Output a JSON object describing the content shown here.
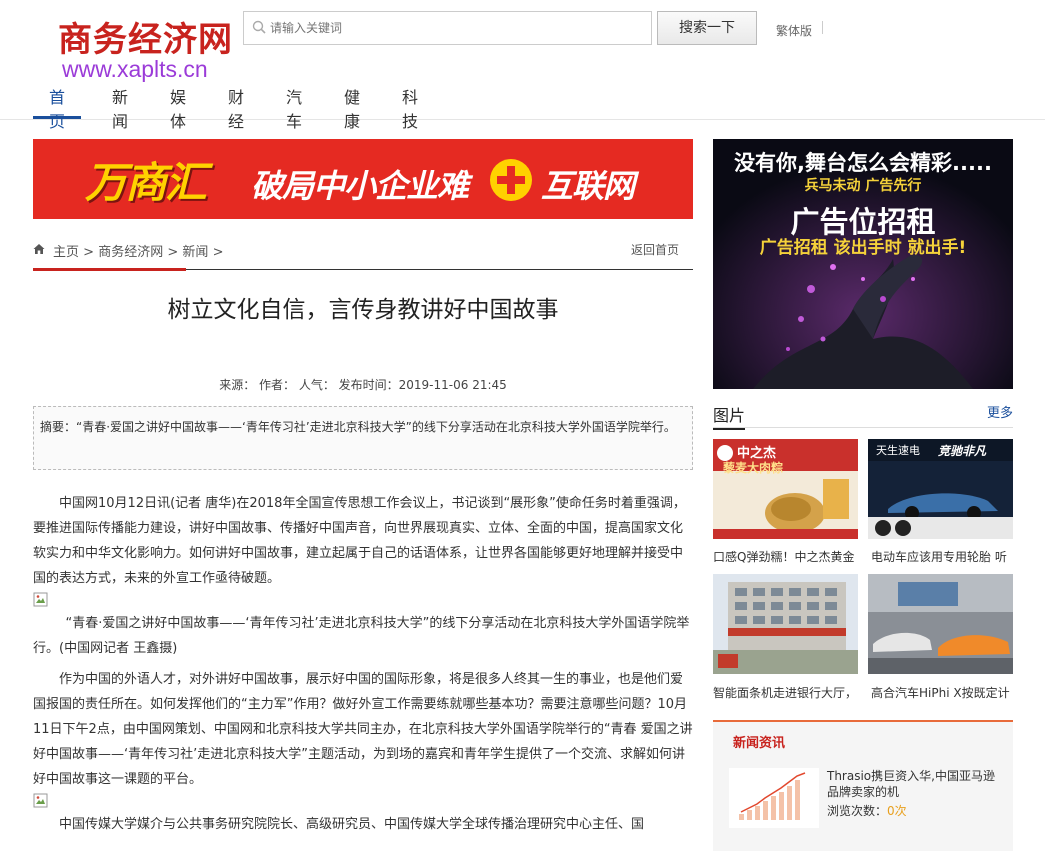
{
  "header": {
    "logo": "商务经济网",
    "url": "www.xaplts.cn",
    "search_placeholder": "请输入关键词",
    "search_button": "搜索一下",
    "traditional": "繁体版"
  },
  "nav": {
    "items": [
      "首页",
      "新闻",
      "娱体",
      "财经",
      "汽车",
      "健康",
      "科技"
    ],
    "active_index": 0
  },
  "banner": {
    "brand": "万商汇",
    "slogan_left": "破局中小企业难",
    "slogan_right": "互联网"
  },
  "breadcrumb": {
    "items": [
      "主页",
      "商务经济网",
      "新闻"
    ],
    "separator": ">",
    "back": "返回首页"
  },
  "article": {
    "title": "树立文化自信，言传身教讲好中国故事",
    "meta": "来源： 作者： 人气： 发布时间：2019-11-06 21:45",
    "summary": "摘要：“青春·爱国之讲好中国故事——‘青年传习社’走进北京科技大学”的线下分享活动在北京科技大学外国语学院举行。",
    "paragraphs": [
      "中国网10月12日讯(记者 唐华)在2018年全国宣传思想工作会议上，书记谈到“展形象”使命任务时着重强调，要推进国际传播能力建设，讲好中国故事、传播好中国声音，向世界展现真实、立体、全面的中国，提高国家文化软实力和中华文化影响力。如何讲好中国故事，建立起属于自己的话语体系，让世界各国能够更好地理解并接受中国的表达方式，未来的外宣工作亟待破题。",
      "“青春·爱国之讲好中国故事——‘青年传习社’走进北京科技大学”的线下分享活动在北京科技大学外国语学院举行。(中国网记者 王鑫摄)",
      "作为中国的外语人才，对外讲好中国故事，展示好中国的国际形象，将是很多人终其一生的事业，也是他们爱国报国的责任所在。如何发挥他们的“主力军”作用？做好外宣工作需要练就哪些基本功？需要注意哪些问题？10月11日下午2点，由中国网策划、中国网和北京科技大学共同主办，在北京科技大学外国语学院举行的“青春 爱国之讲好中国故事——‘青年传习社’走进北京科技大学”主题活动，为到场的嘉宾和青年学生提供了一个交流、求解如何讲好中国故事这一课题的平台。",
      "中国传媒大学媒介与公共事务研究院院长、高级研究员、中国传媒大学全球传播治理研究中心主任、国"
    ]
  },
  "sidebar": {
    "ad": {
      "line1": "没有你,舞台怎么会精彩.....",
      "line2": "兵马未动 广告先行",
      "line3": "广告位招租",
      "line4": "广告招租  该出手时 就出手!"
    },
    "pictures": {
      "title": "图片",
      "more": "更多",
      "items": [
        {
          "caption": "口感Q弹劲糯！中之杰黄金",
          "thumb_text": "中之杰",
          "thumb_sub": "藜麦大肉粽"
        },
        {
          "caption": "电动车应该用专用轮胎 听",
          "thumb_text": "天生速电",
          "thumb_sub": "竞驰非凡"
        },
        {
          "caption": "智能面条机走进银行大厅，"
        },
        {
          "caption": "高合汽车HiPhi X按既定计"
        }
      ]
    },
    "news": {
      "title": "新闻资讯",
      "items": [
        {
          "title": "Thrasio携巨资入华,中国亚马逊品牌卖家的机",
          "views_label": "浏览次数：",
          "views": "0次"
        }
      ]
    }
  },
  "colors": {
    "brand_red": "#c8231e",
    "url_purple": "#9b3bd8",
    "nav_blue": "#1a4f9c",
    "banner_red": "#e52a22",
    "banner_yellow": "#ffd200"
  }
}
